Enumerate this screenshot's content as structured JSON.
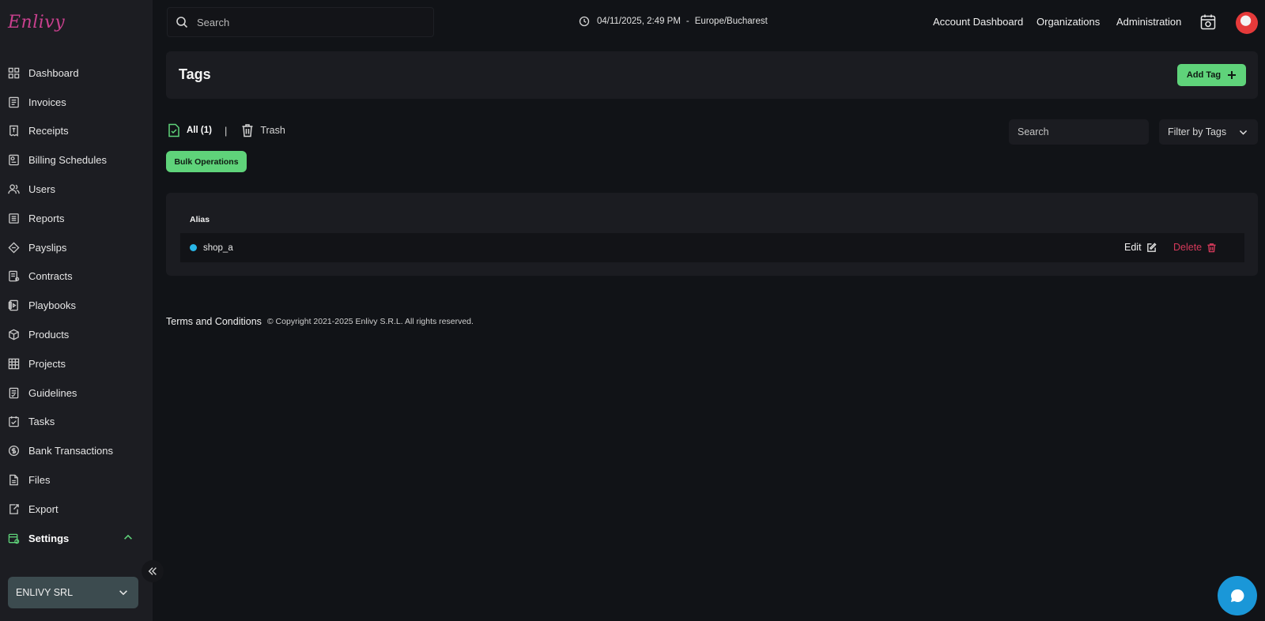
{
  "app": {
    "logo_text": "Enlivy"
  },
  "sidebar": {
    "items": [
      {
        "label": "Dashboard",
        "icon": "dashboard-icon"
      },
      {
        "label": "Invoices",
        "icon": "invoice-icon"
      },
      {
        "label": "Receipts",
        "icon": "receipt-icon"
      },
      {
        "label": "Billing Schedules",
        "icon": "billing-schedule-icon"
      },
      {
        "label": "Users",
        "icon": "users-icon"
      },
      {
        "label": "Reports",
        "icon": "reports-icon"
      },
      {
        "label": "Payslips",
        "icon": "payslip-icon"
      },
      {
        "label": "Contracts",
        "icon": "contract-icon"
      },
      {
        "label": "Playbooks",
        "icon": "playbook-icon"
      },
      {
        "label": "Products",
        "icon": "product-box-icon"
      },
      {
        "label": "Projects",
        "icon": "projects-icon"
      },
      {
        "label": "Guidelines",
        "icon": "guidelines-icon"
      },
      {
        "label": "Tasks",
        "icon": "tasks-icon"
      },
      {
        "label": "Bank Transactions",
        "icon": "bank-transaction-icon"
      },
      {
        "label": "Files",
        "icon": "file-icon"
      },
      {
        "label": "Export",
        "icon": "export-icon"
      },
      {
        "label": "Settings",
        "icon": "settings-icon",
        "active": true,
        "expanded": true
      }
    ],
    "org_selector": "ENLIVY SRL"
  },
  "topbar": {
    "search_placeholder": "Search",
    "datetime": "04/11/2025, 2:49 PM",
    "datetime_separator": "-",
    "timezone": "Europe/Bucharest",
    "links": [
      "Account Dashboard",
      "Organizations",
      "Administration"
    ]
  },
  "page": {
    "title": "Tags",
    "add_button": "Add Tag",
    "tabs": {
      "all": "All (1)",
      "divider": "|",
      "trash": "Trash"
    },
    "search_placeholder": "Search",
    "filter_label": "Filter by Tags",
    "bulk_button": "Bulk Operations"
  },
  "table": {
    "header_alias": "Alias",
    "rows": [
      {
        "alias": "shop_a",
        "color": "#29b6e8",
        "edit": "Edit",
        "delete": "Delete"
      }
    ]
  },
  "footer": {
    "terms": "Terms and Conditions",
    "copyright": "© Copyright 2021-2025 Enlivy S.R.L. All rights reserved."
  },
  "colors": {
    "accent_green": "#5fd37a",
    "danger_red": "#d4395a",
    "chat_blue": "#1a97d8",
    "tag_dot": "#29b6e8"
  }
}
